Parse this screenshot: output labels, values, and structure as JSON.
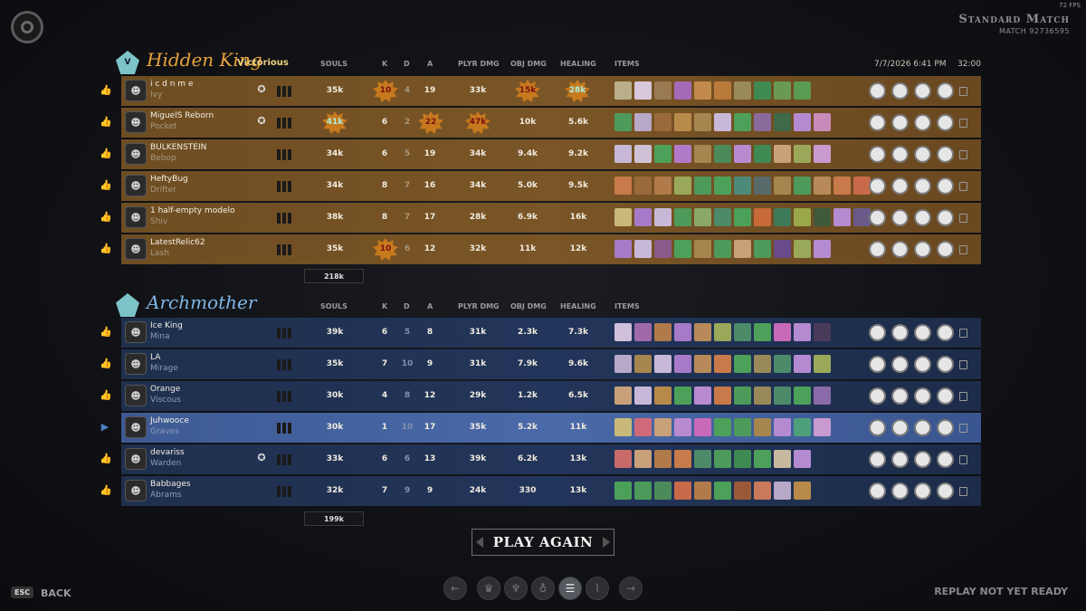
{
  "fps": "72 FPS",
  "match": {
    "title": "Standard Match",
    "id": "MATCH 92736595"
  },
  "columns": {
    "souls": "SOULS",
    "k": "K",
    "d": "D",
    "a": "A",
    "plyr_dmg": "PLYR DMG",
    "obj_dmg": "OBJ DMG",
    "healing": "HEALING",
    "items": "ITEMS"
  },
  "date": "7/7/2026 6:41 PM",
  "duration": "32:00",
  "teams": [
    {
      "name": "Hidden King",
      "badge": "V",
      "status": "Victorious",
      "total_souls": "218k",
      "players": [
        {
          "name": "i c d n m e",
          "hero": "Ivy",
          "souls": "35k",
          "k": "10",
          "d": "4",
          "a": "19",
          "plyr": "33k",
          "obj": "15k",
          "heal": "28k"
        },
        {
          "name": "MiguelS Reborn",
          "hero": "Pocket",
          "souls": "41k",
          "k": "6",
          "d": "2",
          "a": "22",
          "plyr": "47k",
          "obj": "10k",
          "heal": "5.6k"
        },
        {
          "name": "BULKENSTEIN",
          "hero": "Bebop",
          "souls": "34k",
          "k": "6",
          "d": "5",
          "a": "19",
          "plyr": "34k",
          "obj": "9.4k",
          "heal": "9.2k"
        },
        {
          "name": "HeftyBug",
          "hero": "Drifter",
          "souls": "34k",
          "k": "8",
          "d": "7",
          "a": "16",
          "plyr": "34k",
          "obj": "5.0k",
          "heal": "9.5k"
        },
        {
          "name": "1 half-empty modelo",
          "hero": "Shiv",
          "souls": "38k",
          "k": "8",
          "d": "7",
          "a": "17",
          "plyr": "28k",
          "obj": "6.9k",
          "heal": "16k"
        },
        {
          "name": "LatestRelic62",
          "hero": "Lash",
          "souls": "35k",
          "k": "10",
          "d": "6",
          "a": "12",
          "plyr": "32k",
          "obj": "11k",
          "heal": "12k"
        }
      ]
    },
    {
      "name": "Archmother",
      "badge": "",
      "status": "",
      "total_souls": "199k",
      "players": [
        {
          "name": "Ice King",
          "hero": "Mina",
          "souls": "39k",
          "k": "6",
          "d": "5",
          "a": "8",
          "plyr": "31k",
          "obj": "2.3k",
          "heal": "7.3k"
        },
        {
          "name": "LA",
          "hero": "Mirage",
          "souls": "35k",
          "k": "7",
          "d": "10",
          "a": "9",
          "plyr": "31k",
          "obj": "7.9k",
          "heal": "9.6k"
        },
        {
          "name": "Orange",
          "hero": "Viscous",
          "souls": "30k",
          "k": "4",
          "d": "8",
          "a": "12",
          "plyr": "29k",
          "obj": "1.2k",
          "heal": "6.5k"
        },
        {
          "name": "Juhwooce",
          "hero": "Graves",
          "souls": "30k",
          "k": "1",
          "d": "10",
          "a": "17",
          "plyr": "35k",
          "obj": "5.2k",
          "heal": "11k"
        },
        {
          "name": "devariss",
          "hero": "Warden",
          "souls": "33k",
          "k": "6",
          "d": "6",
          "a": "13",
          "plyr": "39k",
          "obj": "6.2k",
          "heal": "13k"
        },
        {
          "name": "Babbages",
          "hero": "Abrams",
          "souls": "32k",
          "k": "7",
          "d": "9",
          "a": "9",
          "plyr": "24k",
          "obj": "330",
          "heal": "13k"
        }
      ]
    }
  ],
  "actions": {
    "play_again": "PLAY AGAIN",
    "esc_key": "ESC",
    "back": "BACK",
    "replay_status": "REPLAY NOT YET READY"
  },
  "nav_icons": [
    "arrow-left-icon",
    "trophy-icon",
    "build-icon",
    "objective-icon",
    "scoreboard-icon",
    "graph-icon",
    "arrow-right-icon"
  ],
  "colors": {
    "gold_team": "#e8a33a",
    "blue_team": "#7fb6e8",
    "highlight_row": "#4a69a8",
    "star_badge": "#c7791e"
  }
}
